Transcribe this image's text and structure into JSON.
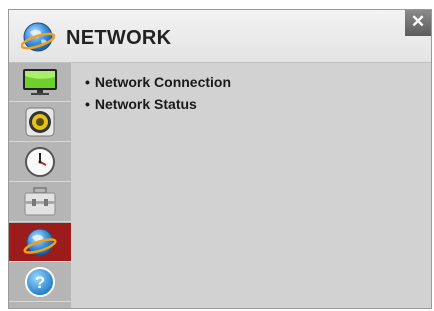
{
  "header": {
    "title": "NETWORK",
    "icon": "globe-icon",
    "close_label": "✕"
  },
  "sidebar": {
    "items": [
      {
        "name": "picture",
        "icon": "tv-icon",
        "active": false
      },
      {
        "name": "audio",
        "icon": "speaker-icon",
        "active": false
      },
      {
        "name": "time",
        "icon": "clock-icon",
        "active": false
      },
      {
        "name": "option",
        "icon": "toolbox-icon",
        "active": false
      },
      {
        "name": "network",
        "icon": "globe-icon",
        "active": true
      },
      {
        "name": "support",
        "icon": "help-icon",
        "active": false
      }
    ]
  },
  "menu": {
    "items": [
      {
        "label": "Network Connection"
      },
      {
        "label": "Network Status"
      }
    ],
    "bullet": "•"
  },
  "colors": {
    "accent": "#9c1c1c",
    "panel": "#d2d2d2",
    "sidebar": "#b5b5b5"
  }
}
